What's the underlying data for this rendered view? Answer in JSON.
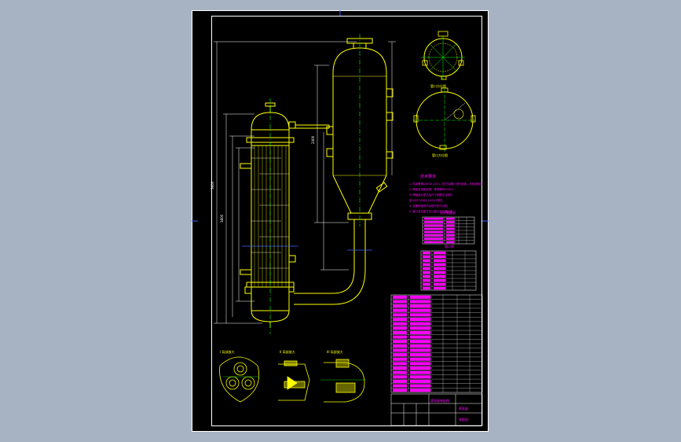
{
  "colors": {
    "background": "#a7b3c2",
    "sheet": "#000000",
    "frame": "#ffffff",
    "outline": "#ffff00",
    "centerline": "#00ff00",
    "table_fill": "#ff00ff",
    "dimension": "#ffffff",
    "tick": "#4060ff"
  },
  "views": {
    "nozzle_top_view": "管口方位图",
    "nozzle_bottom_view": "管口方位图",
    "detail_1": "I 局部放大",
    "detail_2": "II 局部放大",
    "detail_3": "III 局部放大"
  },
  "notes": {
    "title": "技术要求",
    "lines": [
      "1. 本设备按GB150-2011《压力容器》进行制造、试验和验收",
      "2. 焊接采用电弧焊，焊条牌号E4303",
      "3. 焊接接头型式及尺寸除图中注明外",
      "   按HG/T20583-2011中规定",
      "4. 设备制造完毕后进行压力试验",
      "5. 管口及支座方位以管口方位图为准"
    ]
  },
  "tables": {
    "design_data_title": "设计数据表",
    "nozzle_table_title": "管口表",
    "parts_title": "明细表",
    "title_block": {
      "designer": "蒸发器装配图",
      "name": "蒸发器",
      "drawing_no": "装配图"
    }
  }
}
